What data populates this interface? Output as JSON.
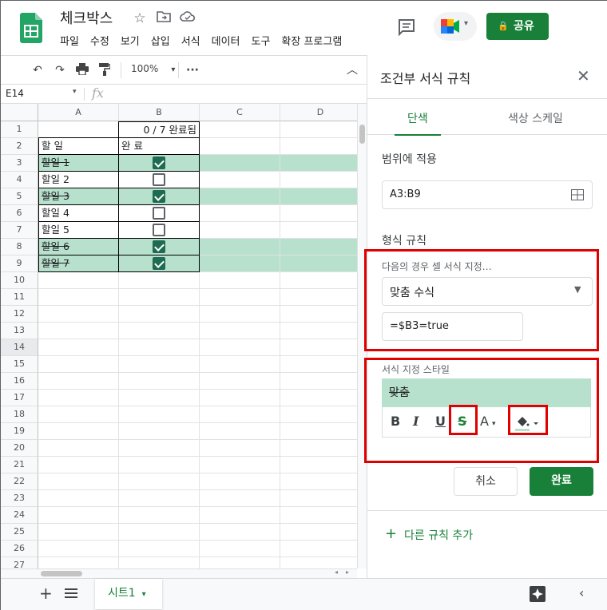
{
  "header": {
    "doc_title": "체크박스",
    "menus": [
      "파일",
      "수정",
      "보기",
      "삽입",
      "서식",
      "데이터",
      "도구",
      "확장 프로그램"
    ],
    "share_label": "공유"
  },
  "toolbar": {
    "zoom": "100%"
  },
  "formula_bar": {
    "name_box": "E14",
    "fx": "fx"
  },
  "grid": {
    "columns": [
      "A",
      "B",
      "C",
      "D"
    ],
    "rows": [
      "1",
      "2",
      "3",
      "4",
      "5",
      "6",
      "7",
      "8",
      "9",
      "10",
      "11",
      "12",
      "13",
      "14",
      "15",
      "16",
      "17",
      "18",
      "19",
      "20",
      "21",
      "22",
      "23",
      "24",
      "25",
      "26",
      "27"
    ],
    "b1": "0 / 7 완료됨",
    "a2": "할 일",
    "b2": "완 료",
    "tasks": [
      {
        "label": "할일 1",
        "done": true
      },
      {
        "label": "할일 2",
        "done": false
      },
      {
        "label": "할일 3",
        "done": true
      },
      {
        "label": "할일 4",
        "done": false
      },
      {
        "label": "할일 5",
        "done": false
      },
      {
        "label": "할일 6",
        "done": true
      },
      {
        "label": "할일 7",
        "done": true
      }
    ],
    "done_color": "#b7e1cd"
  },
  "sheet": {
    "tab_label": "시트1"
  },
  "panel": {
    "title": "조건부 서식 규칙",
    "tab_single": "단색",
    "tab_scale": "색상 스케일",
    "range_label": "범위에 적용",
    "range_value": "A3:B9",
    "rules_label": "형식 규칙",
    "condition_label": "다음의 경우 셀 서식 지정…",
    "condition_value": "맞춤 수식",
    "formula_value": "=$B3=true",
    "style_label": "서식 지정 스타일",
    "style_preview": "맞춤",
    "cancel": "취소",
    "done": "완료",
    "add_rule": "다른 규칙 추가"
  },
  "colors": {
    "accent": "#188038",
    "highlight": "#e00000",
    "done_fill": "#b7e1cd"
  }
}
